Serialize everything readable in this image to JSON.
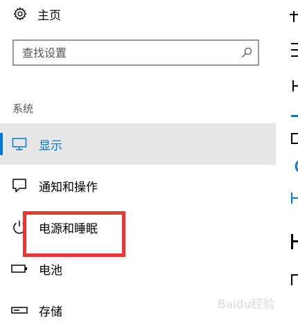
{
  "header": {
    "home_label": "主页",
    "home_icon": "gear-icon"
  },
  "search": {
    "placeholder": "查找设置",
    "icon": "search-icon"
  },
  "section_label": "系统",
  "accent_color": "#0078d7",
  "nav_items": [
    {
      "label": "显示",
      "icon": "monitor-icon",
      "active": true
    },
    {
      "label": "通知和操作",
      "icon": "notification-icon",
      "active": false
    },
    {
      "label": "电源和睡眠",
      "icon": "power-icon",
      "active": false
    },
    {
      "label": "电池",
      "icon": "battery-icon",
      "active": false
    },
    {
      "label": "存储",
      "icon": "storage-icon",
      "active": false
    }
  ],
  "annotation": {
    "color": "#ee3333"
  },
  "watermark_text": "Baidu经验"
}
